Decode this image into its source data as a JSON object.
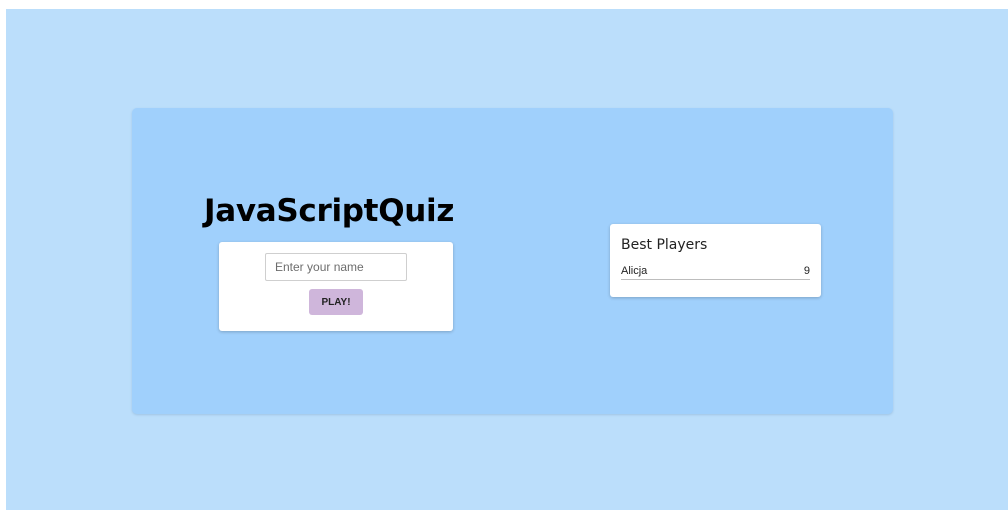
{
  "app": {
    "title": "JavaScriptQuiz"
  },
  "login": {
    "name_input": {
      "value": "",
      "placeholder": "Enter your name"
    },
    "play_label": "PLAY!"
  },
  "leaderboard": {
    "title": "Best Players",
    "players": [
      {
        "name": "Alicja",
        "score": "9"
      }
    ]
  },
  "colors": {
    "page_background": "#bbdefb",
    "panel_background": "#a0d0fc",
    "card_background": "#ffffff",
    "play_button": "#cfb6db"
  }
}
